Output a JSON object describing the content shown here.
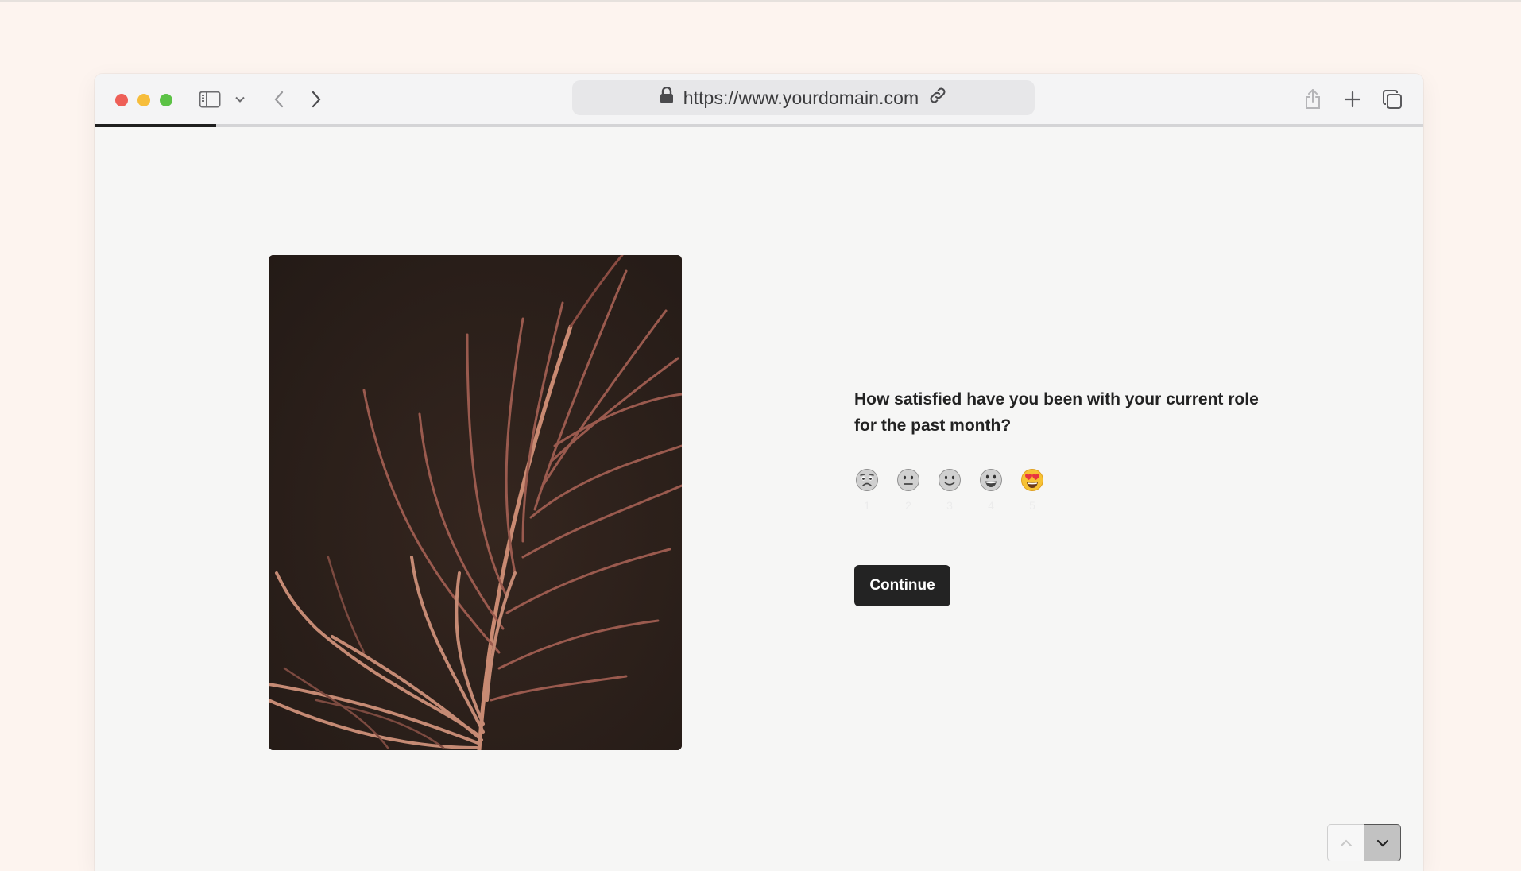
{
  "browser": {
    "url": "https://www.yourdomain.com",
    "progress_fraction": 0.0915
  },
  "survey": {
    "question": "How satisfied have you been with your current role for the past month?",
    "rating_options": [
      {
        "emoji": "worried-face-icon",
        "label": "1"
      },
      {
        "emoji": "neutral-face-icon",
        "label": "2"
      },
      {
        "emoji": "slightly-smiling-face-icon",
        "label": "3"
      },
      {
        "emoji": "grinning-face-icon",
        "label": "4"
      },
      {
        "emoji": "heart-eyes-face-icon",
        "label": "5"
      }
    ],
    "continue_label": "Continue"
  },
  "colors": {
    "page_background": "#fdf4ef",
    "content_background": "#f6f6f5",
    "button_background": "#232323",
    "button_text": "#ffffff"
  }
}
